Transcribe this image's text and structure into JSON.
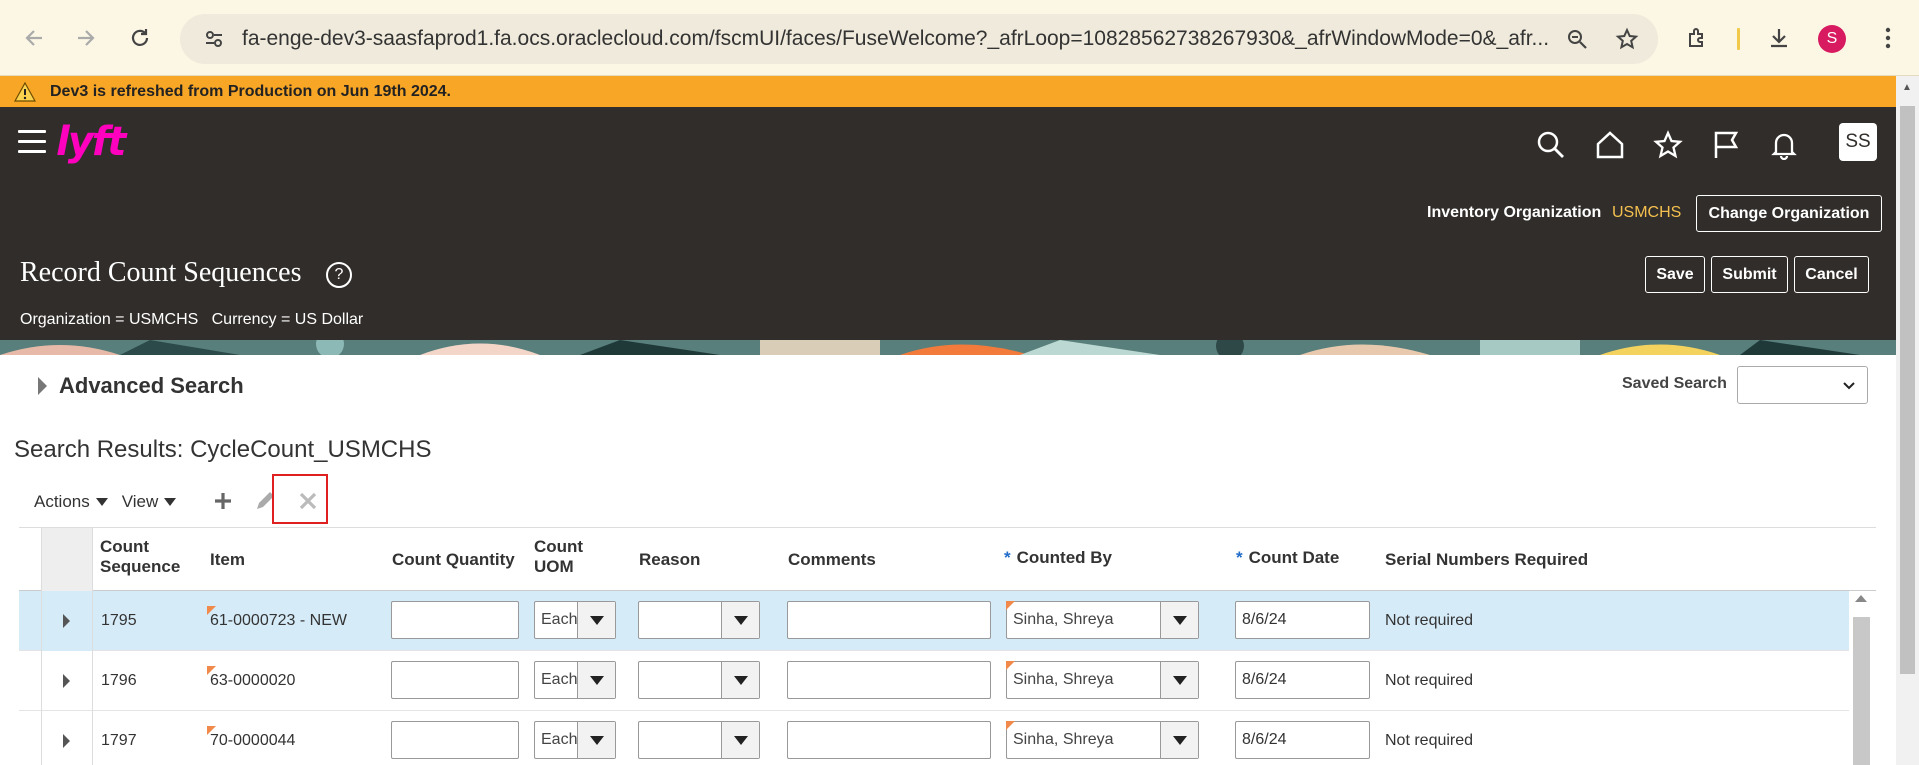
{
  "browser": {
    "url": "fa-enge-dev3-saasfaprod1.fa.ocs.oraclecloud.com/fscmUI/faces/FuseWelcome?_afrLoop=10828562738267930&_afrWindowMode=0&_afr...",
    "profile_initial": "S"
  },
  "banner": {
    "text": "Dev3 is refreshed from Production on Jun 19th 2024."
  },
  "header": {
    "logo": "lyft",
    "avatar": "SS",
    "org_label": "Inventory Organization",
    "org_value": "USMCHS",
    "change_org": "Change Organization",
    "title": "Record Count Sequences",
    "help": "?",
    "context": "Organization = USMCHS   Currency = US Dollar",
    "save": "Save",
    "submit": "Submit",
    "cancel": "Cancel"
  },
  "search": {
    "advanced": "Advanced Search",
    "saved_label": "Saved Search",
    "saved_value": ""
  },
  "results": {
    "title": "Search Results: CycleCount_USMCHS",
    "actions": "Actions",
    "view": "View"
  },
  "table": {
    "headers": {
      "count_sequence": "Count Sequence",
      "item": "Item",
      "count_quantity": "Count Quantity",
      "count_uom": "Count UOM",
      "reason": "Reason",
      "comments": "Comments",
      "counted_by": "Counted By",
      "count_date": "Count Date",
      "serial": "Serial Numbers Required",
      "required_mark": "*"
    },
    "rows": [
      {
        "seq": "1795",
        "item": "61-0000723 - NEW",
        "qty": "",
        "uom": "Each",
        "reason": "",
        "comments": "",
        "counted_by": "Sinha, Shreya",
        "date": "8/6/24",
        "serial": "Not required"
      },
      {
        "seq": "1796",
        "item": "63-0000020",
        "qty": "",
        "uom": "Each",
        "reason": "",
        "comments": "",
        "counted_by": "Sinha, Shreya",
        "date": "8/6/24",
        "serial": "Not required"
      },
      {
        "seq": "1797",
        "item": "70-0000044",
        "qty": "",
        "uom": "Each",
        "reason": "",
        "comments": "",
        "counted_by": "Sinha, Shreya",
        "date": "8/6/24",
        "serial": "Not required"
      }
    ]
  },
  "colors": {
    "banner": "#f8a626",
    "header_bg": "#312d2a",
    "logo": "#ff00bf",
    "org_value": "#f4c04f",
    "selected_row": "#d6ebf8",
    "highlight_box": "#e02020"
  }
}
